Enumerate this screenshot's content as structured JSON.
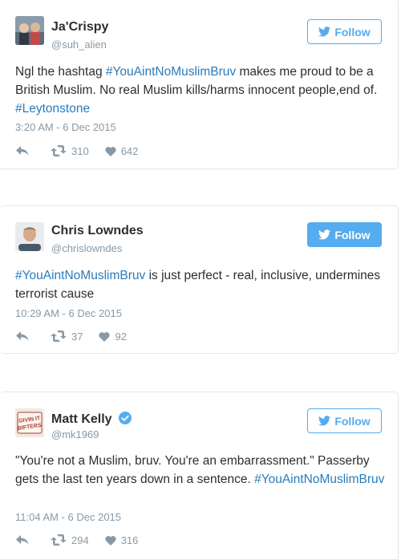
{
  "tweets": [
    {
      "name": "Ja'Crispy",
      "handle": "@suh_alien",
      "verified": false,
      "follow_label": "Follow",
      "follow_style": "outline",
      "text_parts": [
        {
          "text": "Ngl the hashtag ",
          "link": false
        },
        {
          "text": "#YouAintNoMuslimBruv",
          "link": true
        },
        {
          "text": " makes me proud to be a British Muslim. No real Muslim kills/harms innocent people,end of. ",
          "link": false
        },
        {
          "text": "#Leytonstone",
          "link": true
        }
      ],
      "timestamp": "3:20 AM - 6 Dec 2015",
      "retweets": "310",
      "likes": "642"
    },
    {
      "name": "Chris Lowndes",
      "handle": "@chrislowndes",
      "verified": false,
      "follow_label": "Follow",
      "follow_style": "solid",
      "text_parts": [
        {
          "text": "#YouAintNoMuslimBruv",
          "link": true
        },
        {
          "text": " is just perfect -  real, inclusive, undermines terrorist cause",
          "link": false
        }
      ],
      "timestamp": "10:29 AM - 6 Dec 2015",
      "retweets": "37",
      "likes": "92"
    },
    {
      "name": "Matt Kelly",
      "handle": "@mk1969",
      "verified": true,
      "follow_label": "Follow",
      "follow_style": "outline",
      "avatar_text": "GIVIN IT BIFTERS",
      "text_parts": [
        {
          "text": "\"You're not a Muslim, bruv. You're an embarrassment.\" Passerby gets the last ten years down in a sentence. ",
          "link": false
        },
        {
          "text": "#YouAintNoMuslimBruv",
          "link": true
        }
      ],
      "timestamp": "11:04 AM - 6 Dec 2015",
      "retweets": "294",
      "likes": "316"
    }
  ],
  "colors": {
    "link": "#2b7bb9",
    "follow_blue": "#55acee",
    "muted": "#8899a6",
    "border": "#e1e8ed"
  },
  "icons": [
    "twitter-bird-icon",
    "reply-icon",
    "retweet-icon",
    "heart-icon",
    "verified-badge-icon"
  ]
}
